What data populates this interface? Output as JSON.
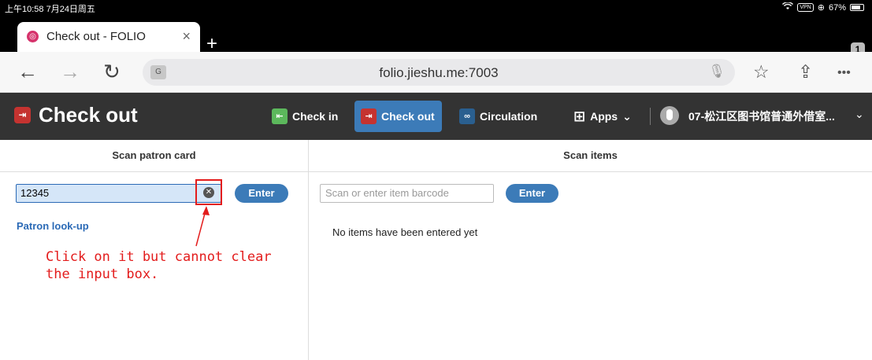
{
  "status_bar": {
    "time": "上午10:58  7月24日周五",
    "wifi": "wifi-icon",
    "vpn": "VPN",
    "battery": "67%"
  },
  "browser": {
    "tab_title": "Check out - FOLIO",
    "tab_count": "1",
    "url": "folio.jieshu.me:7003",
    "icons": [
      "back-icon",
      "forward-icon",
      "reload-icon",
      "translate-icon",
      "mic-icon",
      "star-icon",
      "share-icon",
      "more-icon"
    ]
  },
  "header": {
    "app_title": "Check out",
    "nav": [
      {
        "label": "Check in",
        "color": "#5cb85c"
      },
      {
        "label": "Check out",
        "color": "#c53330"
      },
      {
        "label": "Circulation",
        "color": "#2a5f8f"
      }
    ],
    "apps_label": "Apps",
    "user": "07-松江区图书馆普通外借室..."
  },
  "patron_pane": {
    "heading": "Scan patron card",
    "input_value": "12345",
    "enter_label": "Enter",
    "lookup_link": "Patron look-up"
  },
  "items_pane": {
    "heading": "Scan items",
    "placeholder": "Scan or enter item barcode",
    "enter_label": "Enter",
    "empty_message": "No items have been entered yet"
  },
  "annotation": {
    "text": "Click on it but cannot clear\nthe input box.",
    "color": "#e31c1c"
  }
}
